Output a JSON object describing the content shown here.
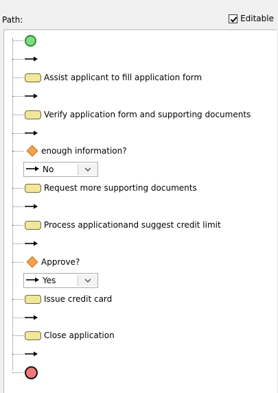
{
  "header": {
    "path_label": "Path:",
    "editable_label": "Editable",
    "editable_checked": true
  },
  "path": {
    "items": [
      {
        "kind": "start",
        "icon": "start-event-icon"
      },
      {
        "kind": "flow",
        "icon": "sequence-arrow-icon"
      },
      {
        "kind": "task",
        "icon": "task-icon",
        "label": "Assist applicant to fill application form"
      },
      {
        "kind": "flow",
        "icon": "sequence-arrow-icon"
      },
      {
        "kind": "task",
        "icon": "task-icon",
        "label": "Verify application form and supporting documents"
      },
      {
        "kind": "flow",
        "icon": "sequence-arrow-icon"
      },
      {
        "kind": "gateway",
        "icon": "gateway-diamond-icon",
        "label": "enough information?"
      },
      {
        "kind": "choice",
        "icon": "sequence-arrow-icon",
        "value": "No"
      },
      {
        "kind": "task",
        "icon": "task-icon",
        "label": "Request more supporting documents"
      },
      {
        "kind": "flow",
        "icon": "sequence-arrow-icon"
      },
      {
        "kind": "task",
        "icon": "task-icon",
        "label": "Process applicationand suggest credit limit"
      },
      {
        "kind": "flow",
        "icon": "sequence-arrow-icon"
      },
      {
        "kind": "gateway",
        "icon": "gateway-diamond-icon",
        "label": "Approve?"
      },
      {
        "kind": "choice",
        "icon": "sequence-arrow-icon",
        "value": "Yes"
      },
      {
        "kind": "task",
        "icon": "task-icon",
        "label": "Issue credit card"
      },
      {
        "kind": "flow",
        "icon": "sequence-arrow-icon"
      },
      {
        "kind": "task",
        "icon": "task-icon",
        "label": "Close application"
      },
      {
        "kind": "flow",
        "icon": "sequence-arrow-icon"
      },
      {
        "kind": "end",
        "icon": "end-event-icon"
      }
    ]
  },
  "colors": {
    "task_fill": "#f1e79b",
    "gateway_fill": "#f4a24d",
    "start_fill": "#7fdc7f",
    "end_fill": "#f07878"
  }
}
